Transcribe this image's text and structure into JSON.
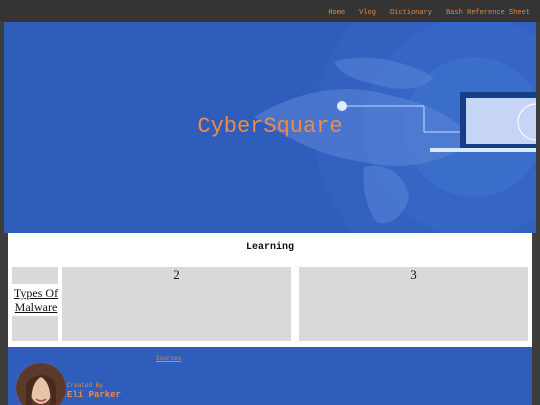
{
  "nav": {
    "links": [
      "Home",
      "Vlog",
      "Dictionary",
      "Bash Reference Sheet"
    ]
  },
  "hero": {
    "title": "CyberSquare"
  },
  "learning": {
    "title": "Learning",
    "cards": [
      {
        "label": "Types Of Malware"
      },
      {
        "label": "2"
      },
      {
        "label": "3"
      }
    ]
  },
  "footer": {
    "sources_label": "Sources",
    "created_label": "Created By",
    "author": "Eli Parker"
  },
  "colors": {
    "accent": "#e3894b",
    "hero_bg": "#2f5dbb",
    "page_bg": "#3d3d3d",
    "card_bg": "#d9d9d9"
  }
}
